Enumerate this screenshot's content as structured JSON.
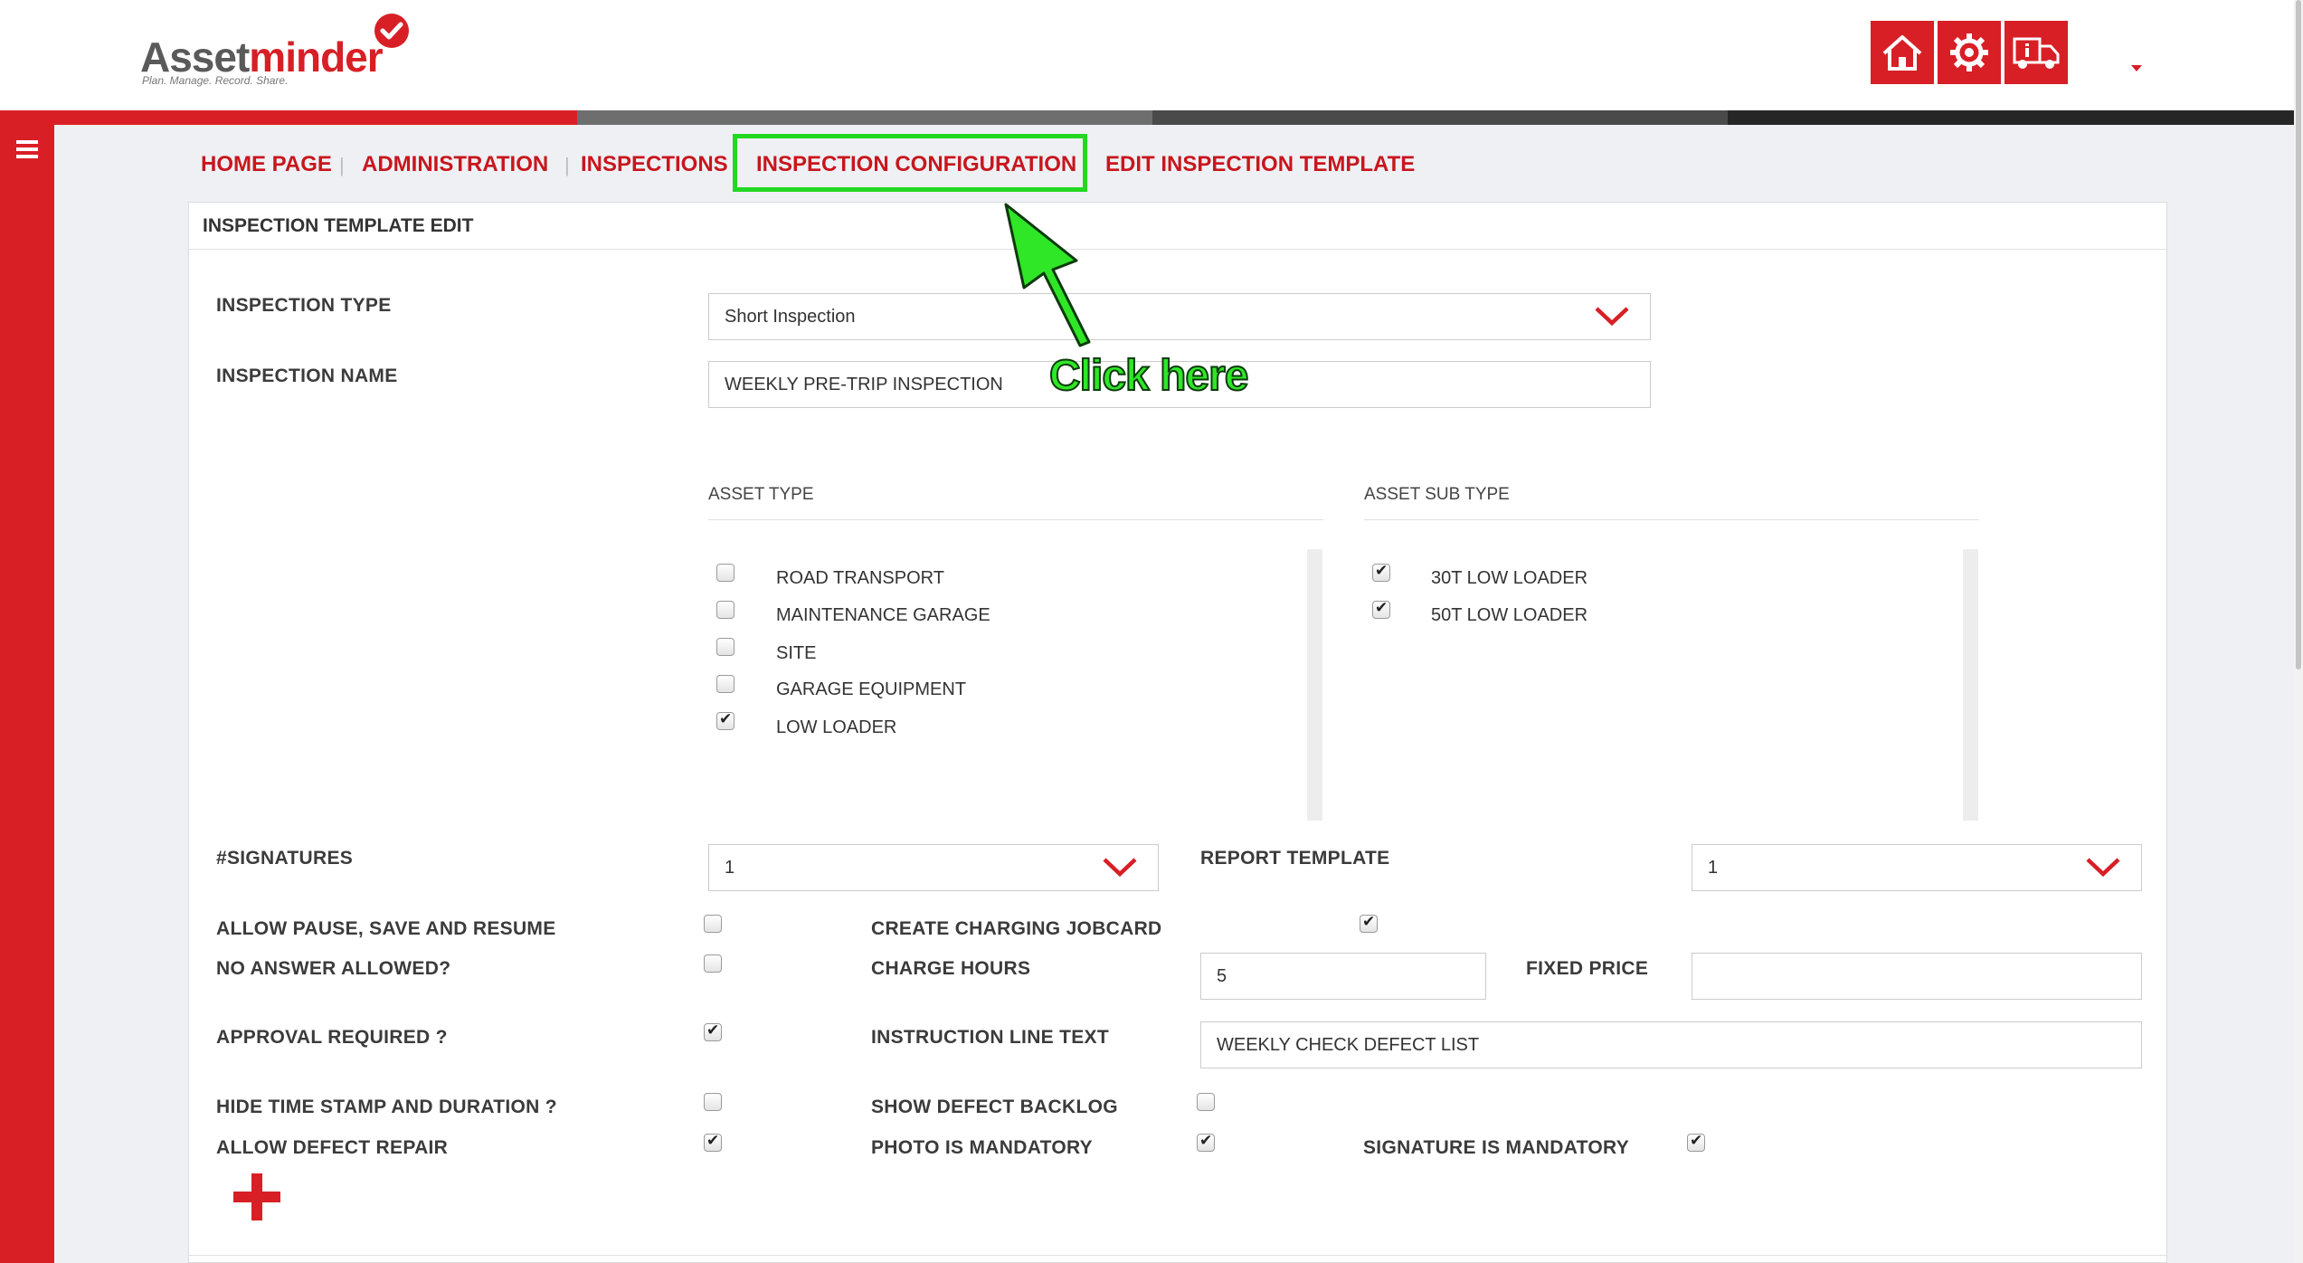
{
  "app": {
    "brand_part1": "Asset",
    "brand_part2": "minder",
    "tagline": "Plan. Manage. Record. Share.",
    "accent": "#d81f26"
  },
  "top_icons": [
    "home-icon",
    "settings-gear-icon",
    "truck-info-icon"
  ],
  "breadcrumb": [
    "HOME PAGE",
    "ADMINISTRATION",
    "INSPECTIONS",
    "INSPECTION CONFIGURATION",
    "EDIT INSPECTION TEMPLATE"
  ],
  "annotation": {
    "callout_text": "Click here",
    "color": "#23d820"
  },
  "panel": {
    "title": "INSPECTION TEMPLATE EDIT",
    "inspection_type_label": "INSPECTION TYPE",
    "inspection_type_value": "Short Inspection",
    "inspection_name_label": "INSPECTION NAME",
    "inspection_name_value": "WEEKLY PRE-TRIP INSPECTION",
    "asset_type_label": "ASSET TYPE",
    "asset_types": [
      {
        "label": "ROAD TRANSPORT",
        "checked": false
      },
      {
        "label": "MAINTENANCE GARAGE",
        "checked": false
      },
      {
        "label": "SITE",
        "checked": false
      },
      {
        "label": "GARAGE EQUIPMENT",
        "checked": false
      },
      {
        "label": "LOW LOADER",
        "checked": true
      }
    ],
    "asset_sub_type_label": "ASSET SUB TYPE",
    "asset_sub_types": [
      {
        "label": "30T LOW LOADER",
        "checked": true
      },
      {
        "label": "50T LOW LOADER",
        "checked": true
      }
    ],
    "signatures_label": "#SIGNATURES",
    "signatures_value": "1",
    "report_template_label": "REPORT TEMPLATE",
    "report_template_value": "1",
    "allow_pause_label": "ALLOW PAUSE, SAVE AND RESUME",
    "allow_pause": false,
    "create_charging_label": "CREATE CHARGING JOBCARD",
    "create_charging": true,
    "no_answer_label": "NO ANSWER ALLOWED?",
    "no_answer": false,
    "charge_hours_label": "CHARGE HOURS",
    "charge_hours_value": "5",
    "fixed_price_label": "FIXED PRICE",
    "fixed_price_value": "",
    "approval_label": "APPROVAL REQUIRED ?",
    "approval": true,
    "instruction_label": "INSTRUCTION LINE TEXT",
    "instruction_value": "WEEKLY CHECK DEFECT LIST",
    "hide_timestamp_label": "HIDE TIME STAMP AND DURATION ?",
    "hide_timestamp": false,
    "show_backlog_label": "SHOW DEFECT BACKLOG",
    "show_backlog": false,
    "allow_defect_label": "ALLOW DEFECT REPAIR",
    "allow_defect": true,
    "photo_mandatory_label": "PHOTO IS MANDATORY",
    "photo_mandatory": true,
    "signature_mandatory_label": "SIGNATURE IS MANDATORY",
    "signature_mandatory": true
  }
}
